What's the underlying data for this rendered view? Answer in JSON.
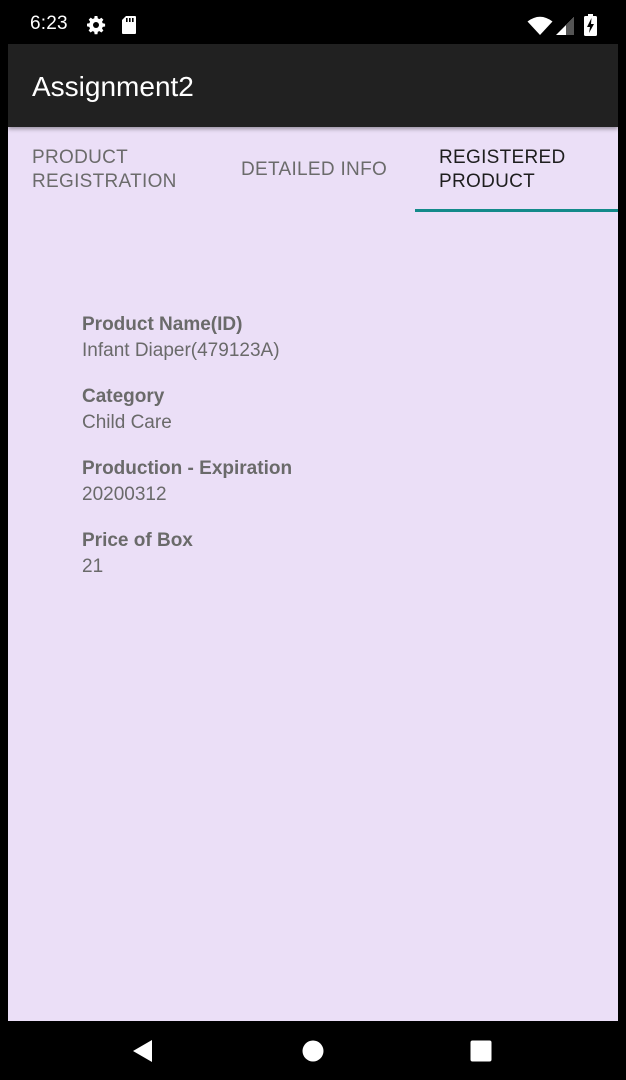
{
  "status_bar": {
    "time": "6:23",
    "icons": [
      "gear-icon",
      "sd-card-icon",
      "wifi-icon",
      "cell-signal-icon",
      "battery-charging-icon"
    ]
  },
  "app_bar": {
    "title": "Assignment2"
  },
  "tabs": [
    {
      "label_line1": "PRODUCT",
      "label_line2": "REGISTRATION",
      "active": false
    },
    {
      "label_line1": "DETAILED INFO",
      "label_line2": "",
      "active": false
    },
    {
      "label_line1": "REGISTERED",
      "label_line2": "PRODUCT",
      "active": true
    }
  ],
  "product": {
    "name_label": "Product Name(ID)",
    "name_value": "Infant Diaper(479123A)",
    "category_label": "Category",
    "category_value": "Child Care",
    "production_label": "Production - Expiration",
    "production_value": "20200312",
    "price_label": "Price of Box",
    "price_value": "21"
  },
  "nav_bar": {
    "icons": [
      "back-icon",
      "home-icon",
      "recents-icon"
    ]
  },
  "colors": {
    "background": "#ebdff7",
    "app_bar": "#212121",
    "tab_indicator": "#138a8a"
  }
}
